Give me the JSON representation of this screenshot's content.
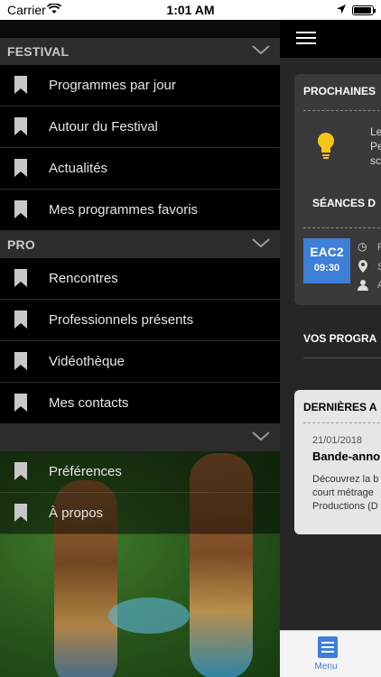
{
  "status_bar": {
    "carrier": "Carrier",
    "time": "1:01 AM"
  },
  "drawer": {
    "sections": [
      {
        "title": "FESTIVAL",
        "items": [
          {
            "label": "Programmes par jour",
            "icon": "bookmark-icon"
          },
          {
            "label": "Autour du Festival",
            "icon": "bookmark-icon"
          },
          {
            "label": "Actualités",
            "icon": "bookmark-icon"
          },
          {
            "label": "Mes programmes favoris",
            "icon": "bookmark-icon"
          }
        ]
      },
      {
        "title": "PRO",
        "items": [
          {
            "label": "Rencontres",
            "icon": "bookmark-icon"
          },
          {
            "label": "Professionnels présents",
            "icon": "bookmark-icon"
          },
          {
            "label": "Vidéothèque",
            "icon": "bookmark-icon"
          },
          {
            "label": "Mes contacts",
            "icon": "bookmark-icon"
          }
        ]
      },
      {
        "title": "",
        "items": [
          {
            "label": "Préférences",
            "icon": "bookmark-icon"
          },
          {
            "label": "À propos",
            "icon": "bookmark-icon"
          }
        ]
      }
    ]
  },
  "main": {
    "card1": {
      "title": "PROCHAINES",
      "tip_lines": [
        "Le",
        "Pe",
        "sc"
      ],
      "seances_title": "SÉANCES D",
      "session": {
        "code": "EAC2",
        "time": "09:30",
        "meta": [
          "F",
          "S",
          "A"
        ]
      }
    },
    "vos_title": "VOS PROGRA",
    "card2": {
      "title": "DERNIÈRES A",
      "date": "21/01/2018",
      "article_title": "Bande-anno",
      "body_lines": [
        "Découvrez la b",
        "court métrage",
        "Productions (D"
      ]
    }
  },
  "tabbar": {
    "menu_label": "Menu"
  },
  "colors": {
    "accent": "#3e7fd8",
    "section_header": "#2c2c2c",
    "drawer_bg": "#000000"
  }
}
